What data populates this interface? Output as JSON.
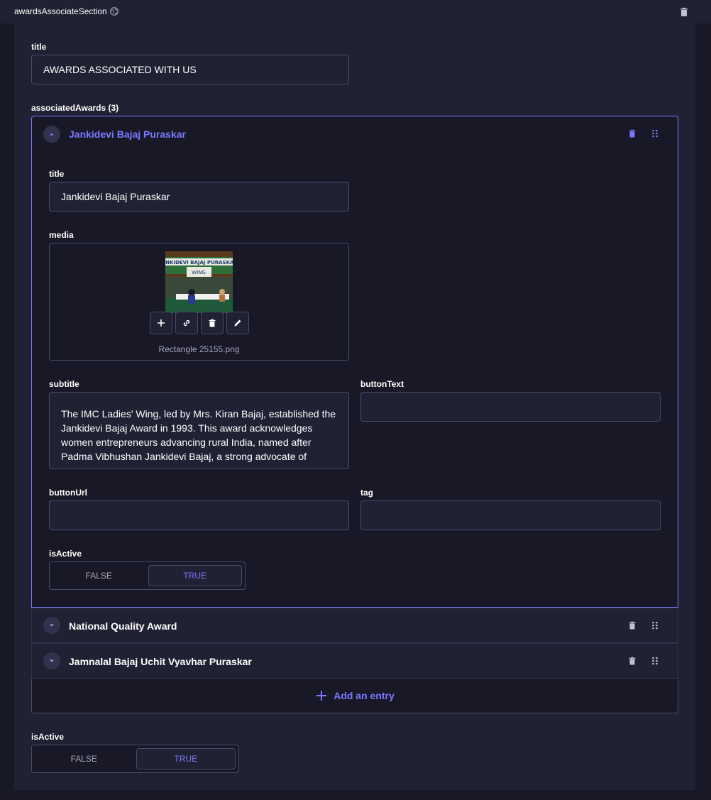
{
  "section": {
    "name": "awardsAssociateSection",
    "globe_icon": "globe-icon",
    "delete_icon": "trash-icon"
  },
  "title_field": {
    "label": "title",
    "value": "AWARDS ASSOCIATED WITH US"
  },
  "associated_awards": {
    "label": "associatedAwards (3)",
    "items": [
      {
        "name": "Jankidevi Bajaj Puraskar",
        "expanded": true,
        "title": {
          "label": "title",
          "value": "Jankidevi Bajaj Puraskar"
        },
        "media": {
          "label": "media",
          "filename": "Rectangle 25155.png",
          "thumb_caption": "JANKIDEVI BAJAJ PURASKAR",
          "thumb_logo": "WING",
          "actions": [
            "plus-icon",
            "link-icon",
            "trash-icon",
            "pencil-icon"
          ]
        },
        "subtitle": {
          "label": "subtitle",
          "value": "The IMC Ladies' Wing, led by Mrs. Kiran Bajaj, established the Jankidevi Bajaj Award in 1993. This award acknowledges women entrepreneurs advancing rural India, named after Padma Vibhushan Jankidevi Bajaj, a strong advocate of"
        },
        "buttonText": {
          "label": "buttonText",
          "value": ""
        },
        "buttonUrl": {
          "label": "buttonUrl",
          "value": ""
        },
        "tag": {
          "label": "tag",
          "value": ""
        },
        "isActive": {
          "label": "isActive",
          "false_label": "FALSE",
          "true_label": "TRUE",
          "value": true
        }
      },
      {
        "name": "National Quality Award",
        "expanded": false
      },
      {
        "name": "Jamnalal Bajaj Uchit Vyavhar Puraskar",
        "expanded": false
      }
    ],
    "add_entry_label": "Add an entry"
  },
  "isActive": {
    "label": "isActive",
    "false_label": "FALSE",
    "true_label": "TRUE",
    "value": true
  },
  "colors": {
    "bg": "#181826",
    "panel": "#212134",
    "border": "#4a4a6a",
    "accent": "#7b79ff",
    "muted": "#a5a5ba"
  }
}
